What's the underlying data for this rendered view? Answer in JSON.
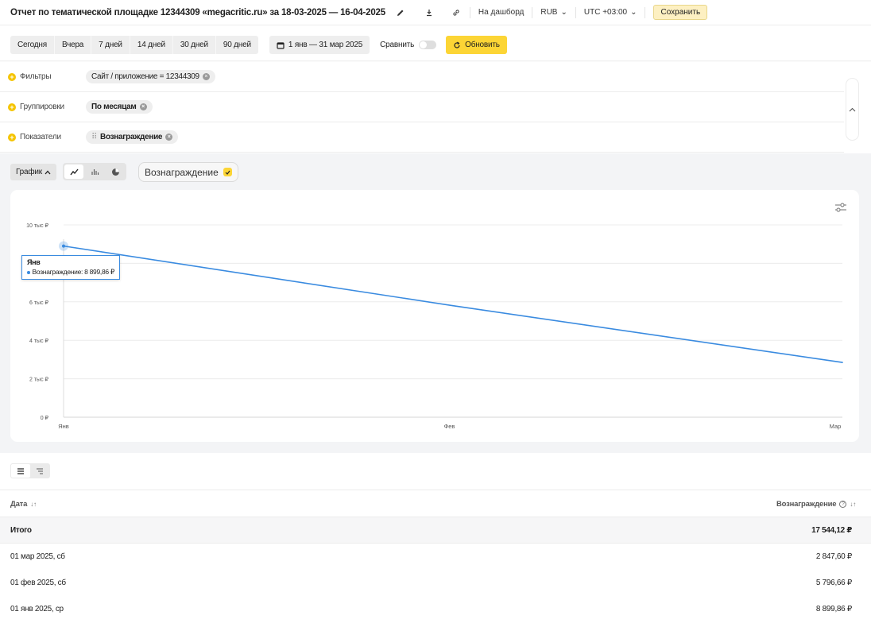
{
  "header": {
    "title": "Отчет по тематической площадке 12344309 «megacritic.ru» за 18-03-2025 — 16-04-2025",
    "dashboard_label": "На дашборд",
    "currency": "RUB",
    "timezone": "UTC +03:00",
    "save_label": "Сохранить"
  },
  "period": {
    "presets": [
      "Сегодня",
      "Вчера",
      "7 дней",
      "14 дней",
      "30 дней",
      "90 дней"
    ],
    "date_range": "1 янв — 31 мар 2025",
    "compare_label": "Сравнить",
    "refresh_label": "Обновить"
  },
  "filters": {
    "filters_label": "Фильтры",
    "filters_chip": "Сайт / приложение = 12344309",
    "groupings_label": "Группировки",
    "groupings_chip": "По месяцам",
    "metrics_label": "Показатели",
    "metrics_chip": "Вознаграждение"
  },
  "chart_controls": {
    "graph_label": "График",
    "metric_label": "Вознаграждение"
  },
  "chart_data": {
    "type": "line",
    "categories": [
      "Янв",
      "Фев",
      "Мар"
    ],
    "series": [
      {
        "name": "Вознаграждение",
        "values": [
          8899.86,
          5796.66,
          2847.6
        ]
      }
    ],
    "ylim": [
      0,
      10000
    ],
    "yticks": [
      0,
      2000,
      4000,
      6000,
      8000,
      10000
    ],
    "ytick_labels": [
      "0 ₽",
      "2 тыс ₽",
      "4 тыс ₽",
      "6 тыс ₽",
      "8 тыс ₽",
      "10 тыс ₽"
    ],
    "color": "#3a8be0",
    "grid": true,
    "tooltip": {
      "title": "Янв",
      "text": "Вознаграждение: 8 899,86 ₽"
    }
  },
  "table": {
    "col_date": "Дата",
    "col_reward": "Вознаграждение",
    "total_label": "Итого",
    "total_value": "17 544,12 ₽",
    "rows": [
      {
        "date": "01 мар 2025, сб",
        "value": "2 847,60 ₽"
      },
      {
        "date": "01 фев 2025, сб",
        "value": "5 796,66 ₽"
      },
      {
        "date": "01 янв 2025, ср",
        "value": "8 899,86 ₽"
      }
    ]
  }
}
